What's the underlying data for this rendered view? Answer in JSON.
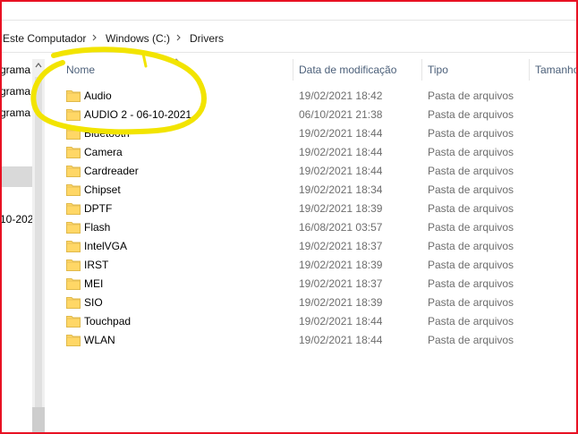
{
  "breadcrumb": {
    "items": [
      "Este Computador",
      "Windows (C:)",
      "Drivers"
    ]
  },
  "nav": {
    "items": [
      "grama",
      "grama",
      "grama",
      "10-202"
    ]
  },
  "columns": {
    "name": "Nome",
    "date": "Data de modificação",
    "type": "Tipo",
    "size": "Tamanho"
  },
  "files": [
    {
      "name": "Audio",
      "date": "19/02/2021 18:42",
      "type": "Pasta de arquivos"
    },
    {
      "name": "AUDIO 2 - 06-10-2021",
      "date": "06/10/2021 21:38",
      "type": "Pasta de arquivos"
    },
    {
      "name": "Bluetooth",
      "date": "19/02/2021 18:44",
      "type": "Pasta de arquivos"
    },
    {
      "name": "Camera",
      "date": "19/02/2021 18:44",
      "type": "Pasta de arquivos"
    },
    {
      "name": "Cardreader",
      "date": "19/02/2021 18:44",
      "type": "Pasta de arquivos"
    },
    {
      "name": "Chipset",
      "date": "19/02/2021 18:34",
      "type": "Pasta de arquivos"
    },
    {
      "name": "DPTF",
      "date": "19/02/2021 18:39",
      "type": "Pasta de arquivos"
    },
    {
      "name": "Flash",
      "date": "16/08/2021 03:57",
      "type": "Pasta de arquivos"
    },
    {
      "name": "IntelVGA",
      "date": "19/02/2021 18:37",
      "type": "Pasta de arquivos"
    },
    {
      "name": "IRST",
      "date": "19/02/2021 18:39",
      "type": "Pasta de arquivos"
    },
    {
      "name": "MEI",
      "date": "19/02/2021 18:37",
      "type": "Pasta de arquivos"
    },
    {
      "name": "SIO",
      "date": "19/02/2021 18:39",
      "type": "Pasta de arquivos"
    },
    {
      "name": "Touchpad",
      "date": "19/02/2021 18:44",
      "type": "Pasta de arquivos"
    },
    {
      "name": "WLAN",
      "date": "19/02/2021 18:44",
      "type": "Pasta de arquivos"
    }
  ],
  "icons": {
    "folder": "folder-icon",
    "breadcrumb_separator": "chevron-right-icon",
    "sort": "sort-ascending-icon",
    "scroll_up": "scroll-up-arrow-icon"
  },
  "colors": {
    "folder": "#ffd766",
    "highlight_annotation": "#f2e400",
    "frame": "#e81123",
    "header_text": "#4c607a"
  }
}
